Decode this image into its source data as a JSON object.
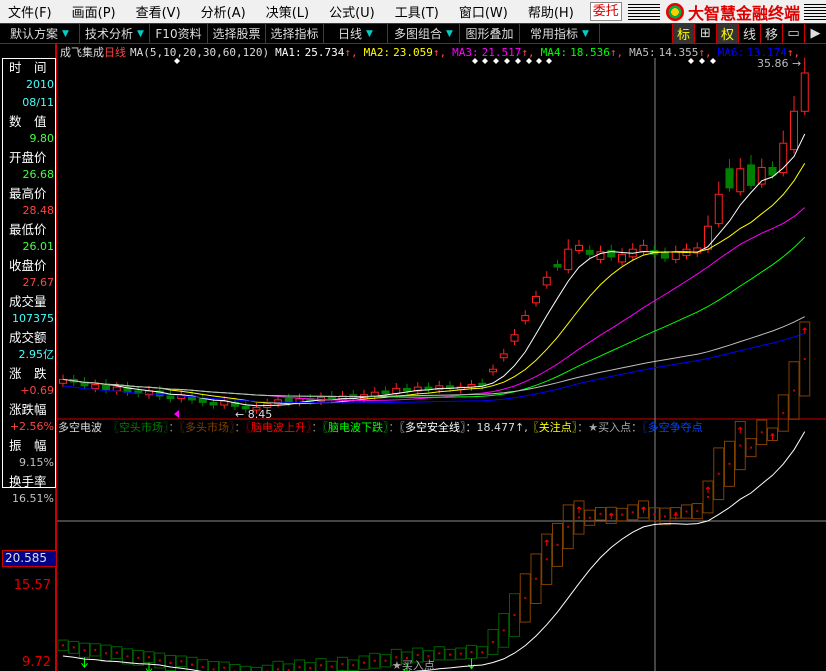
{
  "menu": [
    "文件(F)",
    "画面(P)",
    "查看(V)",
    "分析(A)",
    "决策(L)",
    "公式(U)",
    "工具(T)",
    "窗口(W)",
    "帮助(H)"
  ],
  "weituo": "委托",
  "brand": "大智慧金融终端",
  "toolbar": {
    "items": [
      "默认方案",
      "技术分析",
      "F10资料",
      "选择股票",
      "选择指标",
      "日线",
      "多图组合",
      "图形叠加",
      "常用指标"
    ],
    "icons": [
      "标",
      "⊞",
      "权",
      "线",
      "移",
      "▭",
      "▶"
    ]
  },
  "chart_header": {
    "stock": "成飞集成",
    "period": "日线",
    "ma_params": "MA(5,10,20,30,60,120)",
    "ma": [
      {
        "label": "MA1:",
        "value": "25.734",
        "color": "#ffffff"
      },
      {
        "label": "MA2:",
        "value": "23.059",
        "color": "#ffff00"
      },
      {
        "label": "MA3:",
        "value": "21.517",
        "color": "#ff00ff"
      },
      {
        "label": "MA4:",
        "value": "18.536",
        "color": "#00ff00"
      },
      {
        "label": "MA5:",
        "value": "14.355",
        "color": "#c0c0c0"
      },
      {
        "label": "MA6:",
        "value": "13.174",
        "color": "#0000ff"
      }
    ]
  },
  "info": [
    {
      "label": "时　间",
      "value": "2010",
      "color": "#44ffff"
    },
    {
      "label": "",
      "value": "08/11",
      "color": "#44ffff"
    },
    {
      "label": "数　值",
      "value": "9.80",
      "color": "#44ff44"
    },
    {
      "label": "开盘价",
      "value": "26.68",
      "color": "#44ff44"
    },
    {
      "label": "最高价",
      "value": "28.48",
      "color": "#ff4444"
    },
    {
      "label": "最低价",
      "value": "26.01",
      "color": "#44ff44"
    },
    {
      "label": "收盘价",
      "value": "27.67",
      "color": "#ff4444"
    },
    {
      "label": "成交量",
      "value": "107375",
      "color": "#44ffff"
    },
    {
      "label": "成交额",
      "value": "2.95亿",
      "color": "#44ffff"
    },
    {
      "label": "涨　跌",
      "value": "+0.69",
      "color": "#ff4444"
    },
    {
      "label": "涨跌幅",
      "value": "+2.56%",
      "color": "#ff4444"
    },
    {
      "label": "振　幅",
      "value": "9.15%",
      "color": "#c0c0c0"
    },
    {
      "label": "换手率",
      "value": "16.51%",
      "color": "#c0c0c0"
    }
  ],
  "annotations": {
    "max": "35.86",
    "min": "8.45",
    "top_axis": "35.86"
  },
  "indicator": {
    "name": "多空电波",
    "items": [
      {
        "t": "〖空头市场〗",
        "c": "#008000"
      },
      {
        "t": "：",
        "c": "#888"
      },
      {
        "t": "〖多头市场〗",
        "c": "#804000"
      },
      {
        "t": "：",
        "c": "#888"
      },
      {
        "t": "〖脑电波上升〗",
        "c": "#ff0000"
      },
      {
        "t": "：",
        "c": "#888"
      },
      {
        "t": "〖脑电波下跌〗",
        "c": "#00ff00"
      },
      {
        "t": "：",
        "c": "#888"
      },
      {
        "t": "〖多空安全线〗",
        "c": "#ffffff"
      },
      {
        "t": "：18.477↑,",
        "c": "#ddd"
      },
      {
        "t": "〖关注点〗",
        "c": "#ffff00"
      },
      {
        "t": "：★买入点：",
        "c": "#aaa"
      },
      {
        "t": "〖多空争夺点",
        "c": "#0044ff"
      }
    ],
    "axis": {
      "highlight": "20.585",
      "labels": [
        "15.57",
        "9.72"
      ]
    },
    "buy_label": "★买入点"
  },
  "chart_data": {
    "type": "candlestick",
    "close": [
      11.0,
      10.8,
      10.5,
      10.6,
      10.2,
      10.4,
      10.0,
      9.9,
      10.1,
      9.7,
      9.5,
      9.8,
      9.4,
      9.2,
      9.0,
      9.3,
      8.9,
      8.7,
      8.8,
      9.1,
      9.4,
      9.2,
      9.5,
      9.3,
      9.6,
      9.4,
      9.7,
      9.5,
      9.8,
      10.0,
      9.9,
      10.3,
      10.1,
      10.4,
      10.2,
      10.5,
      10.3,
      10.4,
      10.6,
      10.5,
      11.8,
      13.0,
      14.5,
      16.0,
      17.5,
      19.0,
      19.8,
      21.2,
      21.5,
      20.8,
      21.0,
      20.6,
      20.8,
      21.2,
      21.5,
      20.8,
      20.5,
      21.0,
      21.2,
      21.3,
      23.0,
      25.5,
      26.0,
      27.5,
      26.2,
      27.6,
      27.0,
      29.5,
      32.0,
      35.0
    ],
    "open": [
      10.7,
      11.0,
      10.8,
      10.3,
      10.6,
      10.1,
      10.4,
      10.1,
      9.8,
      10.1,
      9.8,
      9.5,
      9.7,
      9.5,
      9.2,
      9.0,
      9.2,
      8.9,
      8.6,
      8.8,
      9.1,
      9.5,
      9.2,
      9.5,
      9.3,
      9.7,
      9.4,
      9.8,
      9.5,
      9.7,
      10.1,
      9.9,
      10.3,
      10.1,
      10.4,
      10.2,
      10.5,
      10.2,
      10.4,
      10.7,
      11.6,
      12.7,
      14.0,
      15.6,
      17.0,
      18.4,
      20.0,
      19.6,
      21.1,
      21.1,
      20.4,
      21.1,
      20.2,
      20.6,
      21.0,
      21.1,
      20.9,
      20.4,
      20.7,
      20.9,
      21.2,
      23.2,
      27.5,
      25.7,
      27.8,
      26.3,
      27.6,
      27.2,
      29.0,
      32.0
    ],
    "ylim": [
      8.45,
      35.86
    ]
  }
}
